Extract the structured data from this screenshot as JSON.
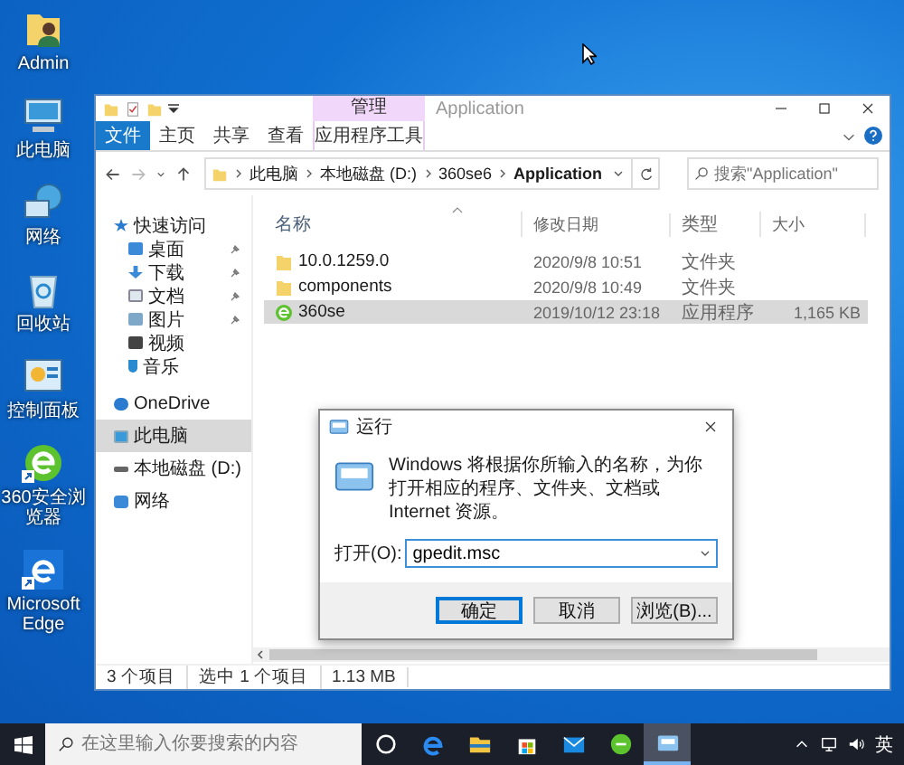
{
  "desktop_icons": [
    {
      "label": "Admin",
      "kind": "user",
      "shortcut": false
    },
    {
      "label": "此电脑",
      "kind": "computer",
      "shortcut": false
    },
    {
      "label": "网络",
      "kind": "network",
      "shortcut": false
    },
    {
      "label": "回收站",
      "kind": "recycle",
      "shortcut": false
    },
    {
      "label": "控制面板",
      "kind": "control",
      "shortcut": false
    },
    {
      "label": "360安全浏览器",
      "kind": "browser360",
      "shortcut": true
    },
    {
      "label": "Microsoft Edge",
      "kind": "edge",
      "shortcut": true
    }
  ],
  "explorer": {
    "context_header": "管理",
    "title": "Application",
    "ribbon_tabs": [
      {
        "label": "文件",
        "kind": "file"
      },
      {
        "label": "主页",
        "kind": "tab"
      },
      {
        "label": "共享",
        "kind": "tab"
      },
      {
        "label": "查看",
        "kind": "tab"
      },
      {
        "label": "应用程序工具",
        "kind": "tool"
      }
    ],
    "breadcrumb": [
      "此电脑",
      "本地磁盘 (D:)",
      "360se6",
      "Application"
    ],
    "search": {
      "placeholder": "搜索\"Application\""
    },
    "nav": [
      {
        "label": "快速访问",
        "kind": "star",
        "pinned": false,
        "selected": false,
        "children": [
          {
            "label": "桌面",
            "kind": "desktop",
            "pinned": true,
            "selected": false
          },
          {
            "label": "下载",
            "kind": "download",
            "pinned": true,
            "selected": false
          },
          {
            "label": "文档",
            "kind": "document",
            "pinned": true,
            "selected": false
          },
          {
            "label": "图片",
            "kind": "picture",
            "pinned": true,
            "selected": false
          },
          {
            "label": "视频",
            "kind": "video",
            "pinned": false,
            "selected": false
          },
          {
            "label": "音乐",
            "kind": "music",
            "pinned": false,
            "selected": false
          }
        ]
      },
      {
        "label": "OneDrive",
        "kind": "cloud",
        "pinned": false,
        "selected": false
      },
      {
        "label": "此电脑",
        "kind": "computer",
        "pinned": false,
        "selected": true
      },
      {
        "label": "本地磁盘 (D:)",
        "kind": "drive",
        "pinned": false,
        "selected": false
      },
      {
        "label": "网络",
        "kind": "network",
        "pinned": false,
        "selected": false
      }
    ],
    "columns": [
      "名称",
      "修改日期",
      "类型",
      "大小"
    ],
    "files": [
      {
        "name": "10.0.1259.0",
        "date": "2020/9/8 10:51",
        "type": "文件夹",
        "kind": "folder",
        "selected": false
      },
      {
        "name": "components",
        "date": "2020/9/8 10:49",
        "type": "文件夹",
        "kind": "folder",
        "selected": false
      },
      {
        "name": "360se",
        "date": "2019/10/12 23:18",
        "type": "应用程序",
        "size": "1,165 KB",
        "kind": "app",
        "selected": true
      }
    ],
    "status": [
      "3 个项目",
      "选中 1 个项目",
      "1.13 MB"
    ]
  },
  "run_dialog": {
    "title": "运行",
    "message": "Windows 将根据你所输入的名称，为你打开相应的程序、文件夹、文档或 Internet 资源。",
    "open_label": "打开(O):",
    "value": "gpedit.msc",
    "buttons": [
      {
        "label": "确定",
        "default": true
      },
      {
        "label": "取消",
        "default": false
      },
      {
        "label": "浏览(B)...",
        "default": false
      }
    ]
  },
  "taskbar": {
    "search_placeholder": "在这里输入你要搜索的内容",
    "apps": [
      {
        "kind": "cortana",
        "active": false
      },
      {
        "kind": "edge",
        "active": false
      },
      {
        "kind": "explorer",
        "active": false
      },
      {
        "kind": "store",
        "active": false
      },
      {
        "kind": "mail",
        "active": false
      },
      {
        "kind": "browser360",
        "active": false
      },
      {
        "kind": "run",
        "active": true
      }
    ],
    "ime": "英"
  }
}
